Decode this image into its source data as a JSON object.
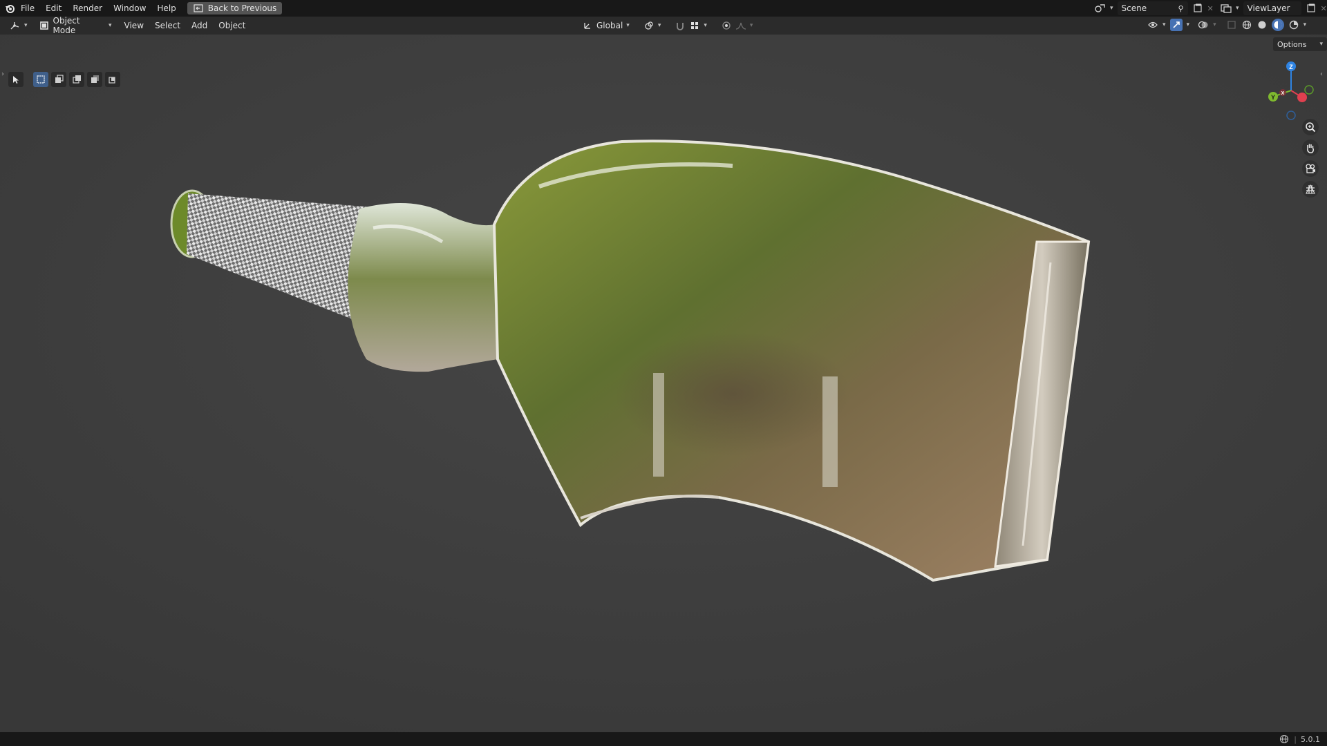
{
  "menu": {
    "items": [
      "File",
      "Edit",
      "Render",
      "Window",
      "Help"
    ],
    "back_button": "Back to Previous",
    "scene_label": "Scene",
    "viewlayer_label": "ViewLayer"
  },
  "header": {
    "mode": "Object Mode",
    "view": "View",
    "select": "Select",
    "add": "Add",
    "object": "Object",
    "orientation": "Global"
  },
  "viewport": {
    "options_label": "Options",
    "gizmo": {
      "z": "Z",
      "y": "Y",
      "x": "X"
    }
  },
  "status": {
    "version": "5.0.1"
  },
  "colors": {
    "accent_blue": "#4772b3",
    "axis_x": "#e0404f",
    "axis_y": "#7fb92f",
    "axis_z": "#2f84e3"
  }
}
